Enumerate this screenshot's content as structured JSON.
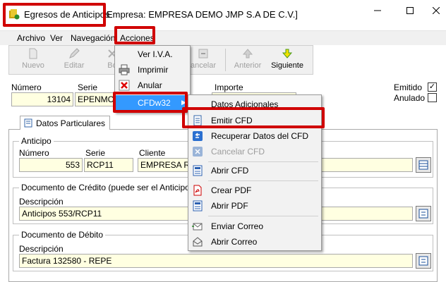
{
  "window": {
    "title": "Egresos de Anticipos",
    "company": "Empresa: EMPRESA DEMO JMP S.A DE C.V.]",
    "minimize": "—",
    "maximize": "☐",
    "close": "✕"
  },
  "menubar": {
    "items": [
      {
        "label": "Archivo"
      },
      {
        "label": "Ver"
      },
      {
        "label": "Navegación"
      },
      {
        "label": "Acciones"
      }
    ]
  },
  "toolbar": {
    "buttons": [
      {
        "label": "Nuevo",
        "icon": "new-document-icon",
        "enabled": false
      },
      {
        "label": "Editar",
        "icon": "edit-pencil-icon",
        "enabled": false
      },
      {
        "label": "Bo",
        "icon": "delete-icon",
        "enabled": false
      },
      {
        "label": "ancelar",
        "icon": "undo-icon",
        "enabled": false
      },
      {
        "label": "Anterior",
        "icon": "up-arrow-icon",
        "enabled": false
      },
      {
        "label": "Siguiente",
        "icon": "down-arrow-icon",
        "enabled": true
      }
    ]
  },
  "header": {
    "numero_label": "Número",
    "numero_value": "13104",
    "serie_label": "Serie",
    "serie_value": "EPENMC",
    "importe_label": "Importe",
    "emitido_label": "Emitido",
    "emitido_checked": true,
    "anulado_label": "Anulado",
    "anulado_checked": false
  },
  "tabs": [
    {
      "label": "Datos Particulares"
    }
  ],
  "anticipo": {
    "title": "Anticipo",
    "numero_label": "Número",
    "numero_value": "553",
    "serie_label": "Serie",
    "serie_value": "RCP11",
    "cliente_label": "Cliente",
    "cliente_value": "EMPRESA RE"
  },
  "credito": {
    "title": "Documento de Crédito (puede ser el Anticipo o un",
    "descripcion_label": "Descripción",
    "descripcion_value": "Anticipos 553/RCP11"
  },
  "debito": {
    "title": "Documento de Débito",
    "descripcion_label": "Descripción",
    "descripcion_value": "Factura 132580 - REPE"
  },
  "acciones_menu": {
    "items": [
      {
        "label": "Ver I.V.A.",
        "icon": "",
        "enabled": true
      },
      {
        "label": "Imprimir",
        "icon": "printer-icon",
        "enabled": true
      },
      {
        "label": "Anular",
        "icon": "cancel-x-icon",
        "enabled": true
      },
      {
        "label": "CFDw32",
        "icon": "",
        "enabled": true,
        "submenu": true
      }
    ]
  },
  "cfd_menu": {
    "items": [
      {
        "label": "Datos Adicionales",
        "icon": "",
        "enabled": true
      },
      {
        "label": "Emitir CFD",
        "icon": "document-icon",
        "enabled": true
      },
      {
        "label": "Recuperar Datos del CFD",
        "icon": "recover-icon",
        "enabled": true
      },
      {
        "label": "Cancelar CFD",
        "icon": "cancel-doc-icon",
        "enabled": false
      },
      {
        "label": "Abrir CFD",
        "icon": "open-doc-icon",
        "enabled": true
      },
      {
        "label": "Crear PDF",
        "icon": "pdf-icon",
        "enabled": true
      },
      {
        "label": "Abrir PDF",
        "icon": "open-pdf-icon",
        "enabled": true
      },
      {
        "label": "Enviar Correo",
        "icon": "send-mail-icon",
        "enabled": true
      },
      {
        "label": "Abrir Correo",
        "icon": "open-mail-icon",
        "enabled": true
      }
    ]
  },
  "colors": {
    "highlight": "#3399ff",
    "field_bg": "#ffffe1",
    "annotation": "#d00000"
  }
}
